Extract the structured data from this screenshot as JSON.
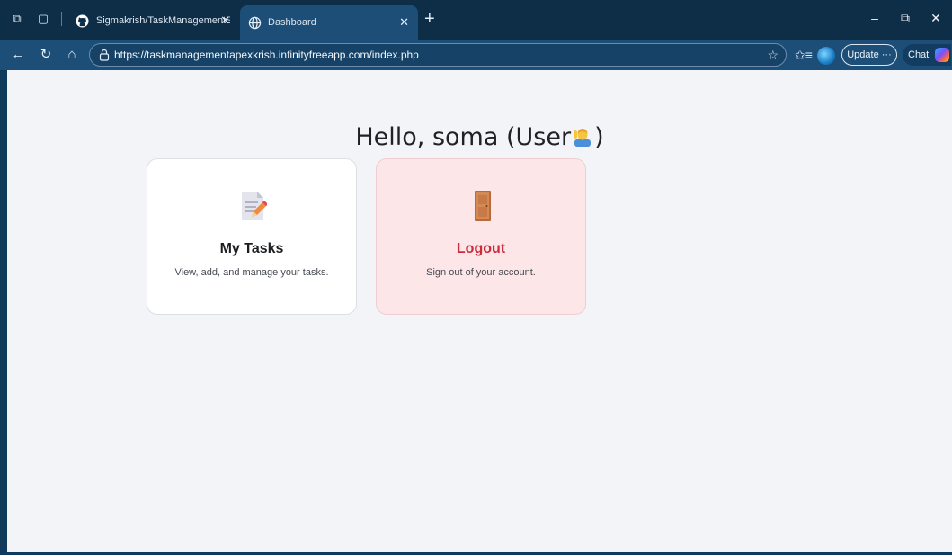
{
  "browser": {
    "tabs": [
      {
        "title": "Sigmakrish/TaskManagementSyst",
        "active": false
      },
      {
        "title": "Dashboard",
        "active": true
      }
    ],
    "url": "https://taskmanagementapexkrish.infinityfreeapp.com/index.php",
    "update_label": "Update ···",
    "chat_label": "Chat"
  },
  "page": {
    "greeting": "Hello, soma (User",
    "greeting_close": ")",
    "cards": [
      {
        "title": "My Tasks",
        "description": "View, add, and manage your tasks.",
        "icon": "memo-icon"
      },
      {
        "title": "Logout",
        "description": "Sign out of your account.",
        "icon": "door-icon"
      }
    ]
  },
  "colors": {
    "accent_logout": "#cc2b3b",
    "logout_card_bg": "#fde6e7",
    "page_bg": "#f3f4f7",
    "browser_frame": "#0e2d47"
  }
}
